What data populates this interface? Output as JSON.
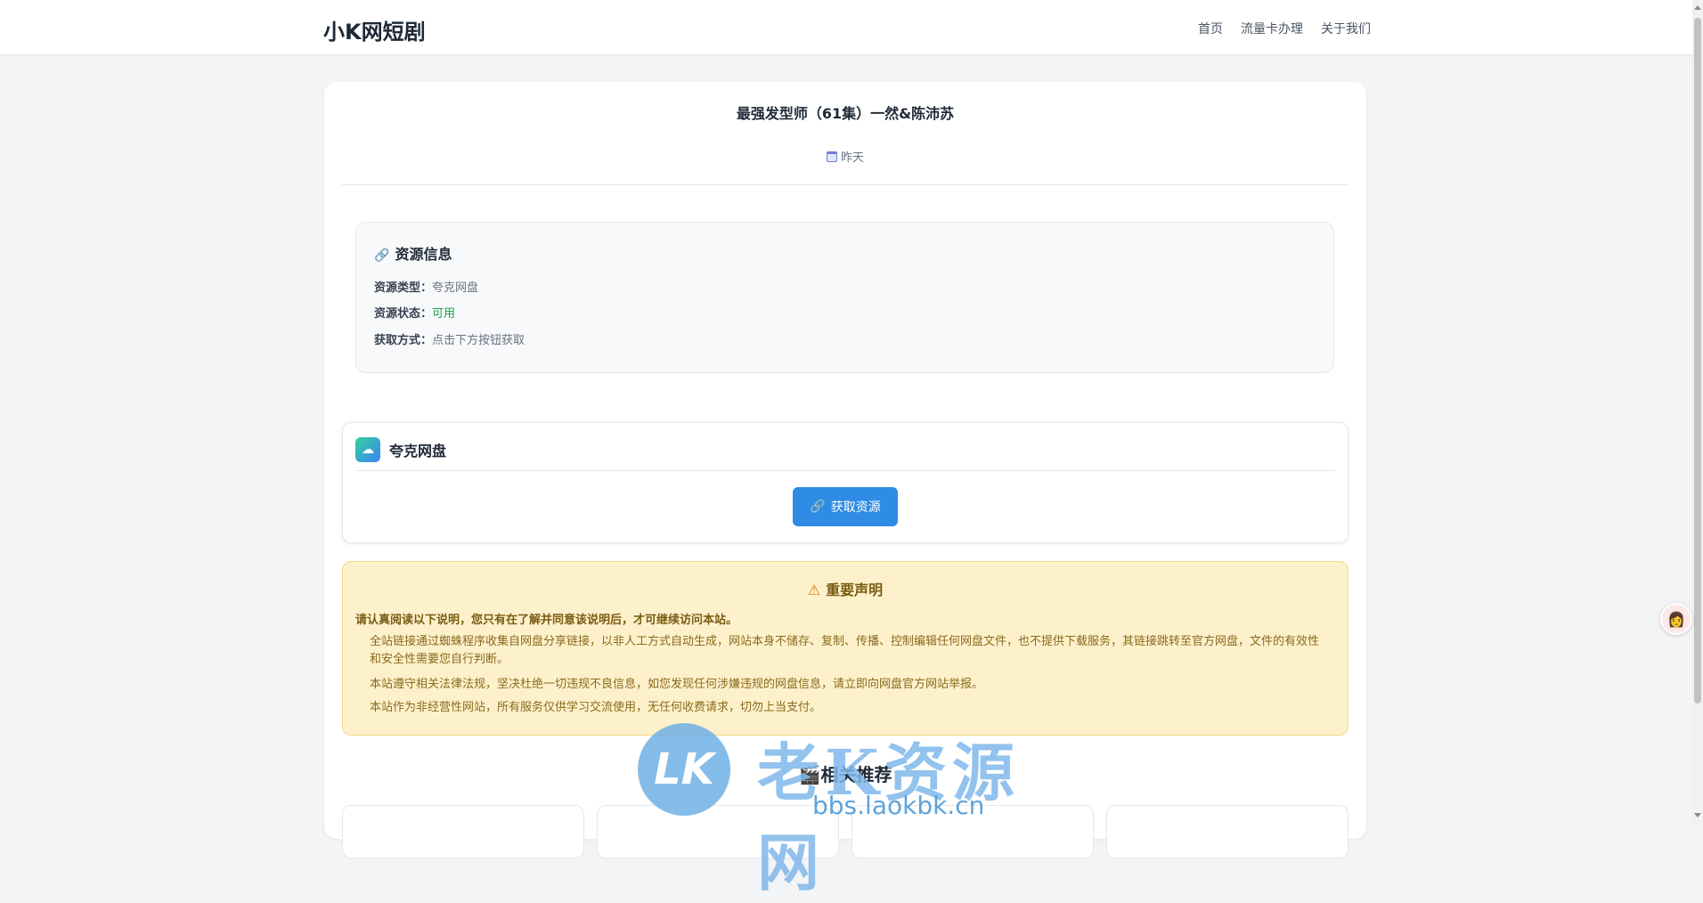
{
  "header": {
    "brand": "小K网短剧",
    "nav": [
      "首页",
      "流量卡办理",
      "关于我们"
    ]
  },
  "article": {
    "title": "最强发型师（61集）一然&陈沛苏",
    "date": "昨天"
  },
  "resource_info": {
    "heading": "资源信息",
    "rows": [
      {
        "label": "资源类型：",
        "value": "夸克网盘"
      },
      {
        "label": "资源状态：",
        "value": "可用"
      },
      {
        "label": "获取方式：",
        "value": "点击下方按钮获取"
      }
    ]
  },
  "pan": {
    "name": "夸克网盘",
    "button_label": "获取资源"
  },
  "notice": {
    "title": "重要声明",
    "lead": "请认真阅读以下说明，您只有在了解并同意该说明后，才可继续访问本站。",
    "paragraphs": [
      "全站链接通过蜘蛛程序收集自网盘分享链接，以非人工方式自动生成，网站本身不储存、复制、传播、控制编辑任何网盘文件，也不提供下载服务，其链接跳转至官方网盘，文件的有效性和安全性需要您自行判断。",
      "本站遵守相关法律法规，坚决杜绝一切违规不良信息，如您发现任何涉嫌违规的网盘信息，请立即向网盘官方网站举报。",
      "本站作为非经营性网站，所有服务仅供学习交流使用，无任何收费请求，切勿上当支付。"
    ]
  },
  "recommend": {
    "title": "相关推荐"
  },
  "watermark": {
    "logo": "LK",
    "text": "老K资源网",
    "url": "bbs.laokbk.cn"
  },
  "colors": {
    "accent": "#2f8ce6",
    "status_ok": "#16a34a",
    "notice_bg": "#fdf1cb"
  }
}
